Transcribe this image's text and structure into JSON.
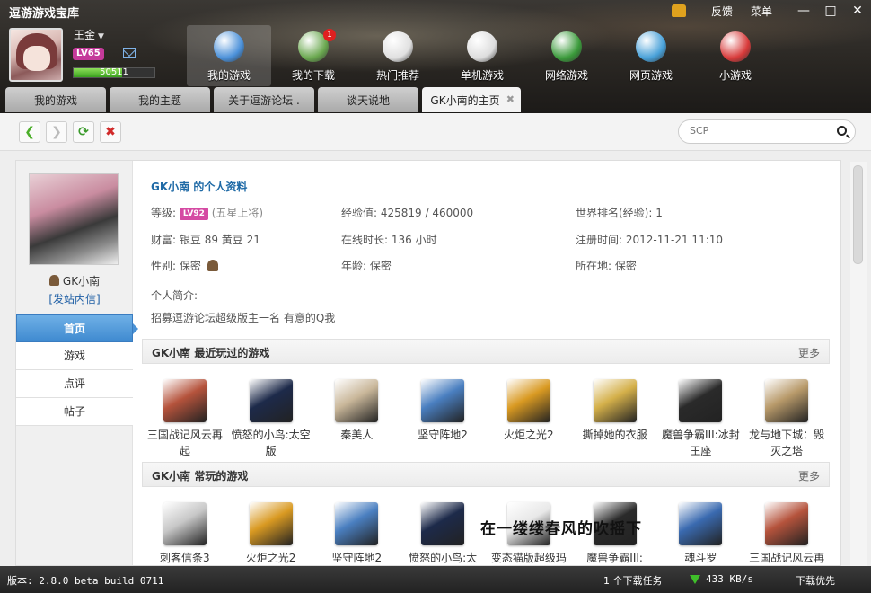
{
  "app": {
    "title": "逗游游戏宝库",
    "top_menu": {
      "feedback": "反馈",
      "menu": "菜单"
    },
    "window_buttons": [
      "minimize",
      "maximize",
      "close"
    ]
  },
  "user": {
    "name": "王金",
    "level": "LV65",
    "exp": "50511"
  },
  "nav": [
    {
      "label": "我的游戏",
      "icon": "my-games-icon",
      "color": "#4a90d9"
    },
    {
      "label": "我的下载",
      "icon": "download-icon",
      "color": "#6aa84f",
      "badge": "1"
    },
    {
      "label": "热门推荐",
      "icon": "hot-recommend-icon",
      "color": "#e0e0e0"
    },
    {
      "label": "单机游戏",
      "icon": "gamepad-icon",
      "color": "#dddddd"
    },
    {
      "label": "网络游戏",
      "icon": "network-game-icon",
      "color": "#3a9a3a"
    },
    {
      "label": "网页游戏",
      "icon": "web-game-icon",
      "color": "#47a0d8"
    },
    {
      "label": "小游戏",
      "icon": "joystick-icon",
      "color": "#d83a3a"
    }
  ],
  "tabs": [
    "我的游戏",
    "我的主题",
    "关于逗游论坛 .",
    "谈天说地",
    "GK小南的主页"
  ],
  "toolbar": {
    "search_placeholder": "SCP"
  },
  "profile": {
    "name": "GK小南",
    "send_message": "[发站内信]",
    "side_nav": [
      "首页",
      "游戏",
      "点评",
      "帖子"
    ],
    "title": "GK小南 的个人资料",
    "level_label": "等级:",
    "level_badge": "LV92",
    "level_title": "(五星上将)",
    "exp_label": "经验值:",
    "exp_value": "425819 / 460000",
    "rank_label": "世界排名(经验):",
    "rank_value": "1",
    "wealth_label": "财富:",
    "wealth_value": "银豆 89  黄豆 21",
    "online_label": "在线时长:",
    "online_value": "136 小时",
    "register_label": "注册时间:",
    "register_value": "2012-11-21 11:10",
    "gender_label": "性别:",
    "gender_value": "保密",
    "age_label": "年龄:",
    "age_value": "保密",
    "location_label": "所在地:",
    "location_value": "保密",
    "bio_label": "个人简介:",
    "bio_value": "招募逗游论坛超级版主一名 有意的Q我"
  },
  "recent": {
    "title": "GK小南  最近玩过的游戏",
    "more": "更多",
    "games": [
      {
        "name": "三国战记风云再起",
        "color": "#b5533c"
      },
      {
        "name": "愤怒的小鸟:太空版",
        "color": "#1d2a4a"
      },
      {
        "name": "秦美人",
        "color": "#c9b79a"
      },
      {
        "name": "坚守阵地2",
        "color": "#4a7fc0"
      },
      {
        "name": "火炬之光2",
        "color": "#d99a22"
      },
      {
        "name": "撕掉她的衣服",
        "color": "#d4b04a"
      },
      {
        "name": "魔兽争霸III:冰封王座",
        "color": "#2a2a2a"
      },
      {
        "name": "龙与地下城：毁灭之塔",
        "color": "#b89a6a"
      }
    ]
  },
  "frequent": {
    "title": "GK小南  常玩的游戏",
    "more": "更多",
    "games": [
      {
        "name": "刺客信条3",
        "color": "#c7c7c7"
      },
      {
        "name": "火炬之光2",
        "color": "#d99a22"
      },
      {
        "name": "坚守阵地2",
        "color": "#4a7fc0"
      },
      {
        "name": "愤怒的小鸟:太",
        "color": "#1d2a4a"
      },
      {
        "name": "变态猫版超级玛",
        "color": "#e8e8e8"
      },
      {
        "name": "魔兽争霸III:",
        "color": "#2a2a2a"
      },
      {
        "name": "魂斗罗",
        "color": "#3a6ab0"
      },
      {
        "name": "三国战记风云再",
        "color": "#b5533c"
      }
    ]
  },
  "overlay_text": "在一缕缕春风的吹摇下",
  "status": {
    "version": "版本: 2.8.0 beta build 0711",
    "downloads": "1 个下载任务",
    "speed": "433 KB/s",
    "priority": "下载优先"
  }
}
